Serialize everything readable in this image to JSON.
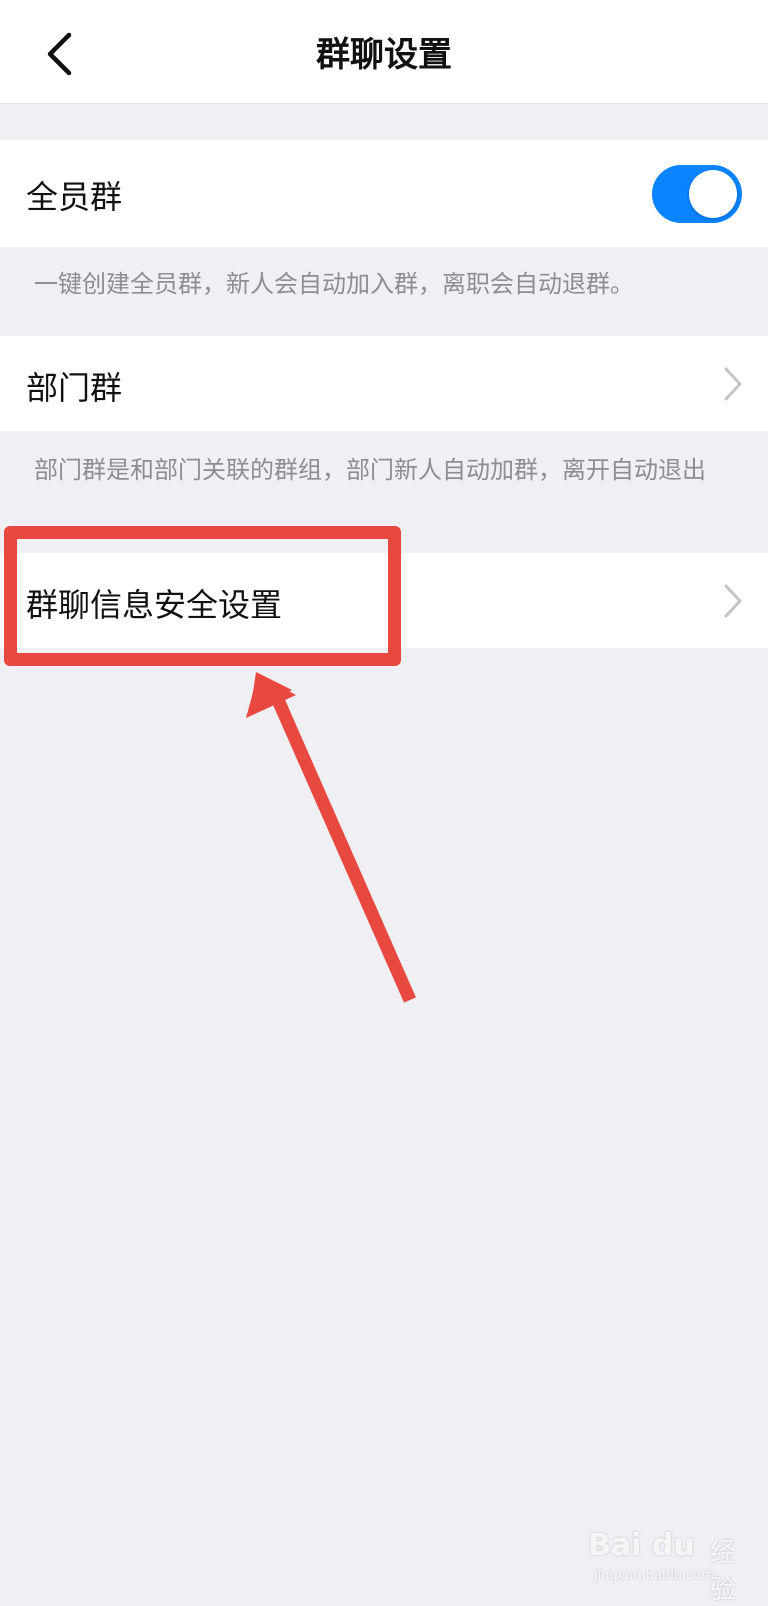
{
  "header": {
    "title": "群聊设置",
    "back_icon": "chevron-left-icon"
  },
  "all_staff_group": {
    "label": "全员群",
    "toggle_on": true,
    "toggle_color": "#0a84ff",
    "description": "一键创建全员群，新人会自动加入群，离职会自动退群。"
  },
  "department_group": {
    "label": "部门群",
    "description": "部门群是和部门关联的群组，部门新人自动加群，离开自动退出",
    "chevron_icon": "chevron-right-icon"
  },
  "security_settings": {
    "label": "群聊信息安全设置",
    "chevron_icon": "chevron-right-icon"
  },
  "annotation": {
    "color": "#e8493f"
  },
  "watermark": {
    "logo": "Bai du",
    "text": "经验",
    "url": "jingyan.baidu.com"
  }
}
